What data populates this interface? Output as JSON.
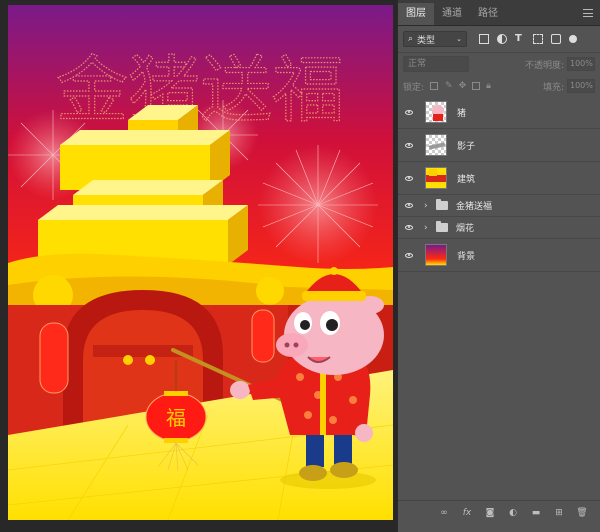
{
  "panel": {
    "tabs": [
      {
        "label": "图层",
        "active": true
      },
      {
        "label": "通道",
        "active": false
      },
      {
        "label": "路径",
        "active": false
      }
    ],
    "filter_label": "类型",
    "blend_mode": "正常",
    "opacity_label": "不透明度:",
    "opacity_value": "100%",
    "lock_label": "锁定:",
    "fill_label": "填充:",
    "fill_value": "100%",
    "layers": [
      {
        "name": "猪",
        "type": "layer",
        "thumb": "pig"
      },
      {
        "name": "影子",
        "type": "layer",
        "thumb": "shadow"
      },
      {
        "name": "建筑",
        "type": "layer",
        "thumb": "building"
      },
      {
        "name": "金猪送福",
        "type": "group"
      },
      {
        "name": "烟花",
        "type": "group"
      },
      {
        "name": "背景",
        "type": "layer",
        "thumb": "background"
      }
    ],
    "bottom_icons": [
      "link-icon",
      "fx-icon",
      "mask-icon",
      "adjustment-icon",
      "group-icon",
      "new-layer-icon",
      "trash-icon"
    ]
  },
  "canvas": {
    "title_text": "金猪送福",
    "lantern_text": "福",
    "colors": {
      "sky_top": "#7a1a8a",
      "sky_bottom": "#ff1a1a",
      "gold": "#ffe000",
      "wall_red": "#d8281a",
      "pig_pink": "#f6b6c4"
    }
  }
}
